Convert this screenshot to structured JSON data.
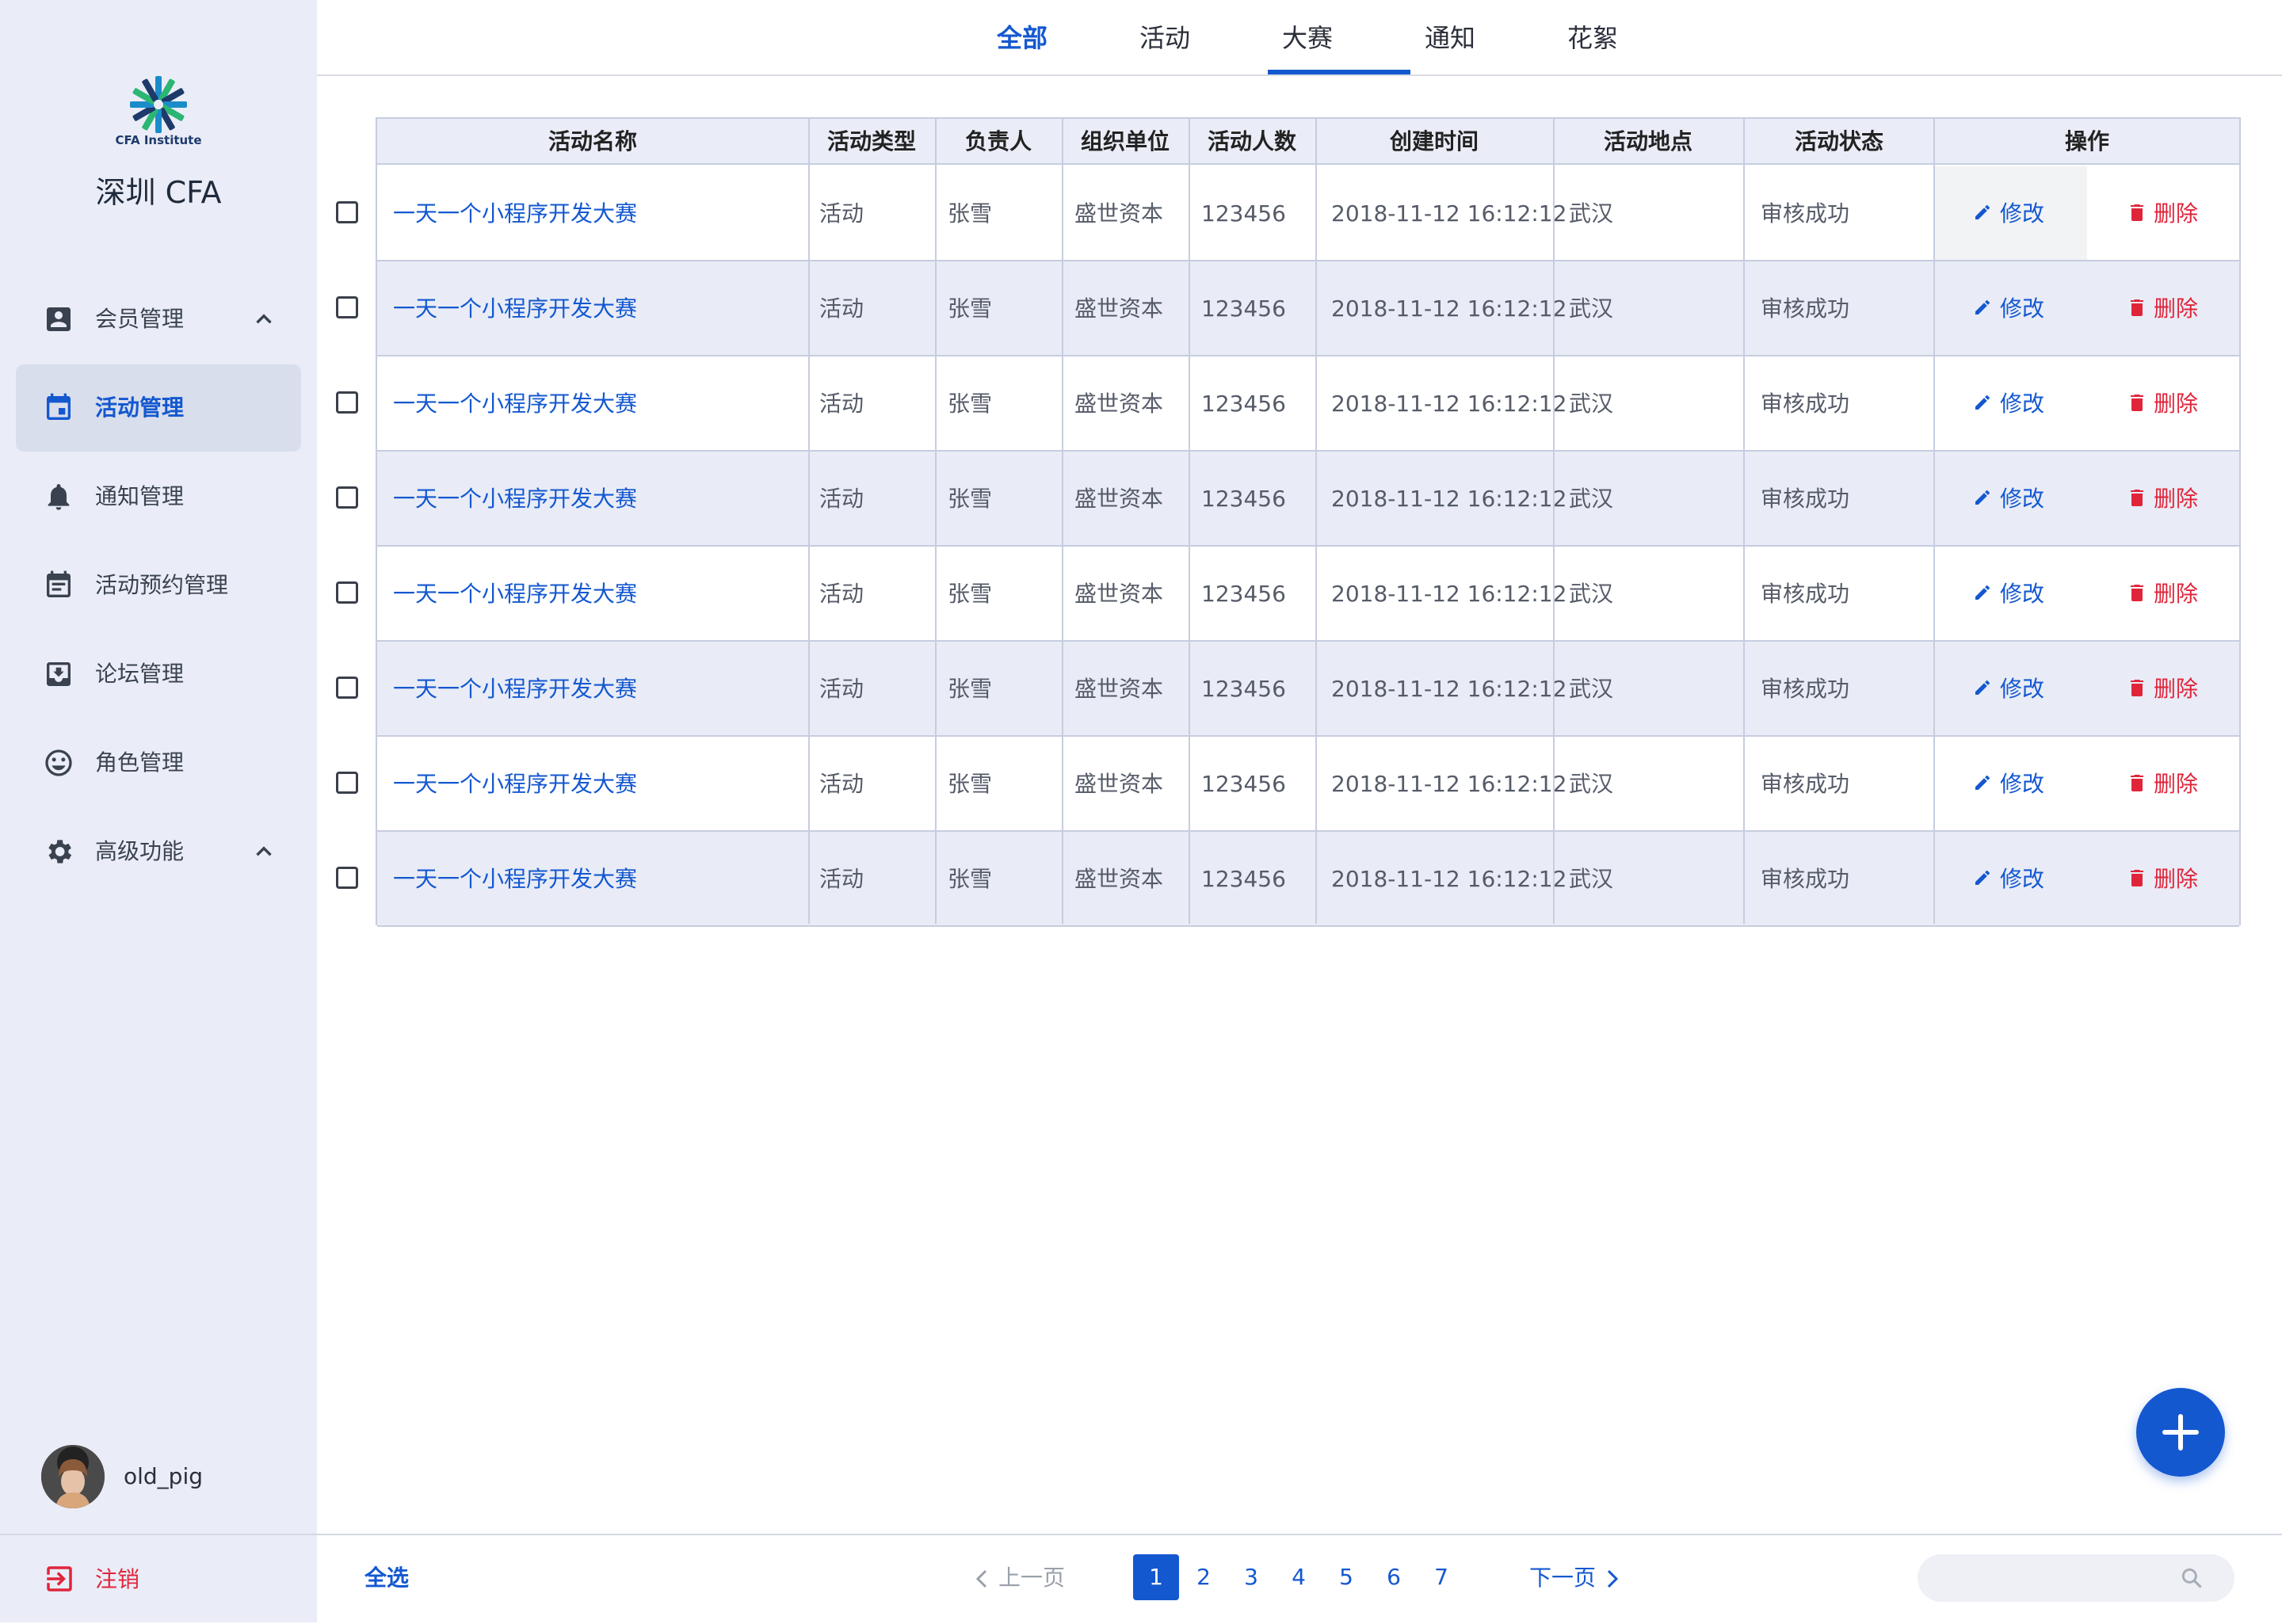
{
  "sidebar": {
    "logo_text": "CFA Institute",
    "title": "深圳 CFA",
    "items": [
      {
        "label": "会员管理",
        "icon": "account-box-icon",
        "expanded": true
      },
      {
        "label": "活动管理",
        "icon": "calendar-icon",
        "active": true
      },
      {
        "label": "通知管理",
        "icon": "bell-icon"
      },
      {
        "label": "活动预约管理",
        "icon": "event-note-icon"
      },
      {
        "label": "论坛管理",
        "icon": "inbox-download-icon"
      },
      {
        "label": "角色管理",
        "icon": "smiley-icon"
      },
      {
        "label": "高级功能",
        "icon": "gear-icon",
        "expanded": true
      }
    ],
    "user": {
      "name": "old_pig"
    },
    "logout_label": "注销"
  },
  "tabs": [
    "全部",
    "活动",
    "大赛",
    "通知",
    "花絮"
  ],
  "active_tab": "全部",
  "table": {
    "headers": [
      "活动名称",
      "活动类型",
      "负责人",
      "组织单位",
      "活动人数",
      "创建时间",
      "活动地点",
      "活动状态",
      "操作"
    ],
    "rows": [
      [
        "一天一个小程序开发大赛",
        "活动",
        "张雪",
        "盛世资本",
        "123456",
        "2018-11-12 16:12:12",
        "武汉",
        "审核成功"
      ],
      [
        "一天一个小程序开发大赛",
        "活动",
        "张雪",
        "盛世资本",
        "123456",
        "2018-11-12 16:12:12",
        "武汉",
        "审核成功"
      ],
      [
        "一天一个小程序开发大赛",
        "活动",
        "张雪",
        "盛世资本",
        "123456",
        "2018-11-12 16:12:12",
        "武汉",
        "审核成功"
      ],
      [
        "一天一个小程序开发大赛",
        "活动",
        "张雪",
        "盛世资本",
        "123456",
        "2018-11-12 16:12:12",
        "武汉",
        "审核成功"
      ],
      [
        "一天一个小程序开发大赛",
        "活动",
        "张雪",
        "盛世资本",
        "123456",
        "2018-11-12 16:12:12",
        "武汉",
        "审核成功"
      ],
      [
        "一天一个小程序开发大赛",
        "活动",
        "张雪",
        "盛世资本",
        "123456",
        "2018-11-12 16:12:12",
        "武汉",
        "审核成功"
      ],
      [
        "一天一个小程序开发大赛",
        "活动",
        "张雪",
        "盛世资本",
        "123456",
        "2018-11-12 16:12:12",
        "武汉",
        "审核成功"
      ],
      [
        "一天一个小程序开发大赛",
        "活动",
        "张雪",
        "盛世资本",
        "123456",
        "2018-11-12 16:12:12",
        "武汉",
        "审核成功"
      ]
    ],
    "edit_label": "修改",
    "delete_label": "删除"
  },
  "footer": {
    "select_all": "全选",
    "prev": "上一页",
    "next": "下一页",
    "pages": [
      "1",
      "2",
      "3",
      "4",
      "5",
      "6",
      "7"
    ],
    "current_page": "1",
    "search_placeholder": ""
  },
  "colors": {
    "accent": "#1458d0",
    "danger": "#e0253b",
    "sidebar_bg": "#eaedf7"
  }
}
